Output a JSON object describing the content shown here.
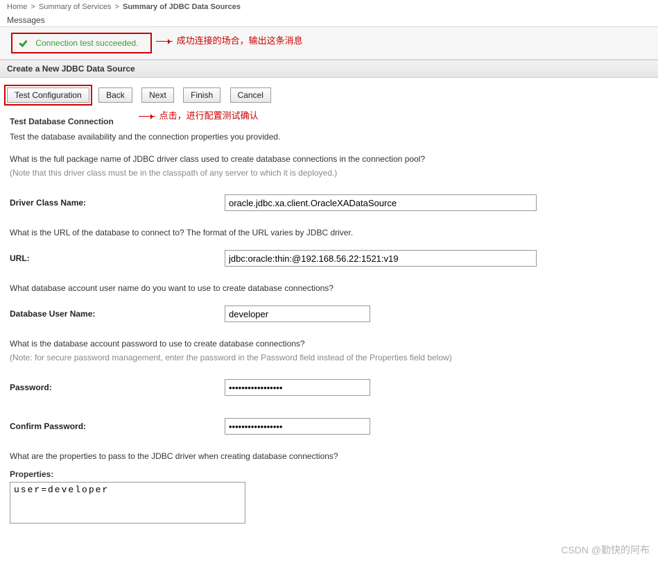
{
  "breadcrumb": {
    "home": "Home",
    "summary_services": "Summary of Services",
    "current": "Summary of JDBC Data Sources"
  },
  "messages": {
    "label": "Messages",
    "success": "Connection test succeeded."
  },
  "annotations": {
    "success_note": "成功连接的场合，输出这条消息",
    "test_note": "点击，进行配置测试确认"
  },
  "section": {
    "title": "Create a New JDBC Data Source"
  },
  "buttons": {
    "test": "Test Configuration",
    "back": "Back",
    "next": "Next",
    "finish": "Finish",
    "cancel": "Cancel"
  },
  "form": {
    "subheader": "Test Database Connection",
    "subdesc": "Test the database availability and the connection properties you provided.",
    "q_driver": "What is the full package name of JDBC driver class used to create database connections in the connection pool?",
    "note_driver": "(Note that this driver class must be in the classpath of any server to which it is deployed.)",
    "label_driver": "Driver Class Name:",
    "val_driver": "oracle.jdbc.xa.client.OracleXADataSource",
    "q_url": "What is the URL of the database to connect to? The format of the URL varies by JDBC driver.",
    "label_url": "URL:",
    "val_url": "jdbc:oracle:thin:@192.168.56.22:1521:v19",
    "q_user": "What database account user name do you want to use to create database connections?",
    "label_user": "Database User Name:",
    "val_user": "developer",
    "q_pw": "What is the database account password to use to create database connections?",
    "note_pw": "(Note: for secure password management, enter the password in the Password field instead of the Properties field below)",
    "label_pw": "Password:",
    "val_pw": "•••••••••••••••••",
    "label_cpw": "Confirm Password:",
    "val_cpw": "•••••••••••••••••",
    "q_props": "What are the properties to pass to the JDBC driver when creating database connections?",
    "label_props": "Properties:",
    "val_props": "user=developer"
  },
  "watermark": "CSDN @勤快的阿布"
}
